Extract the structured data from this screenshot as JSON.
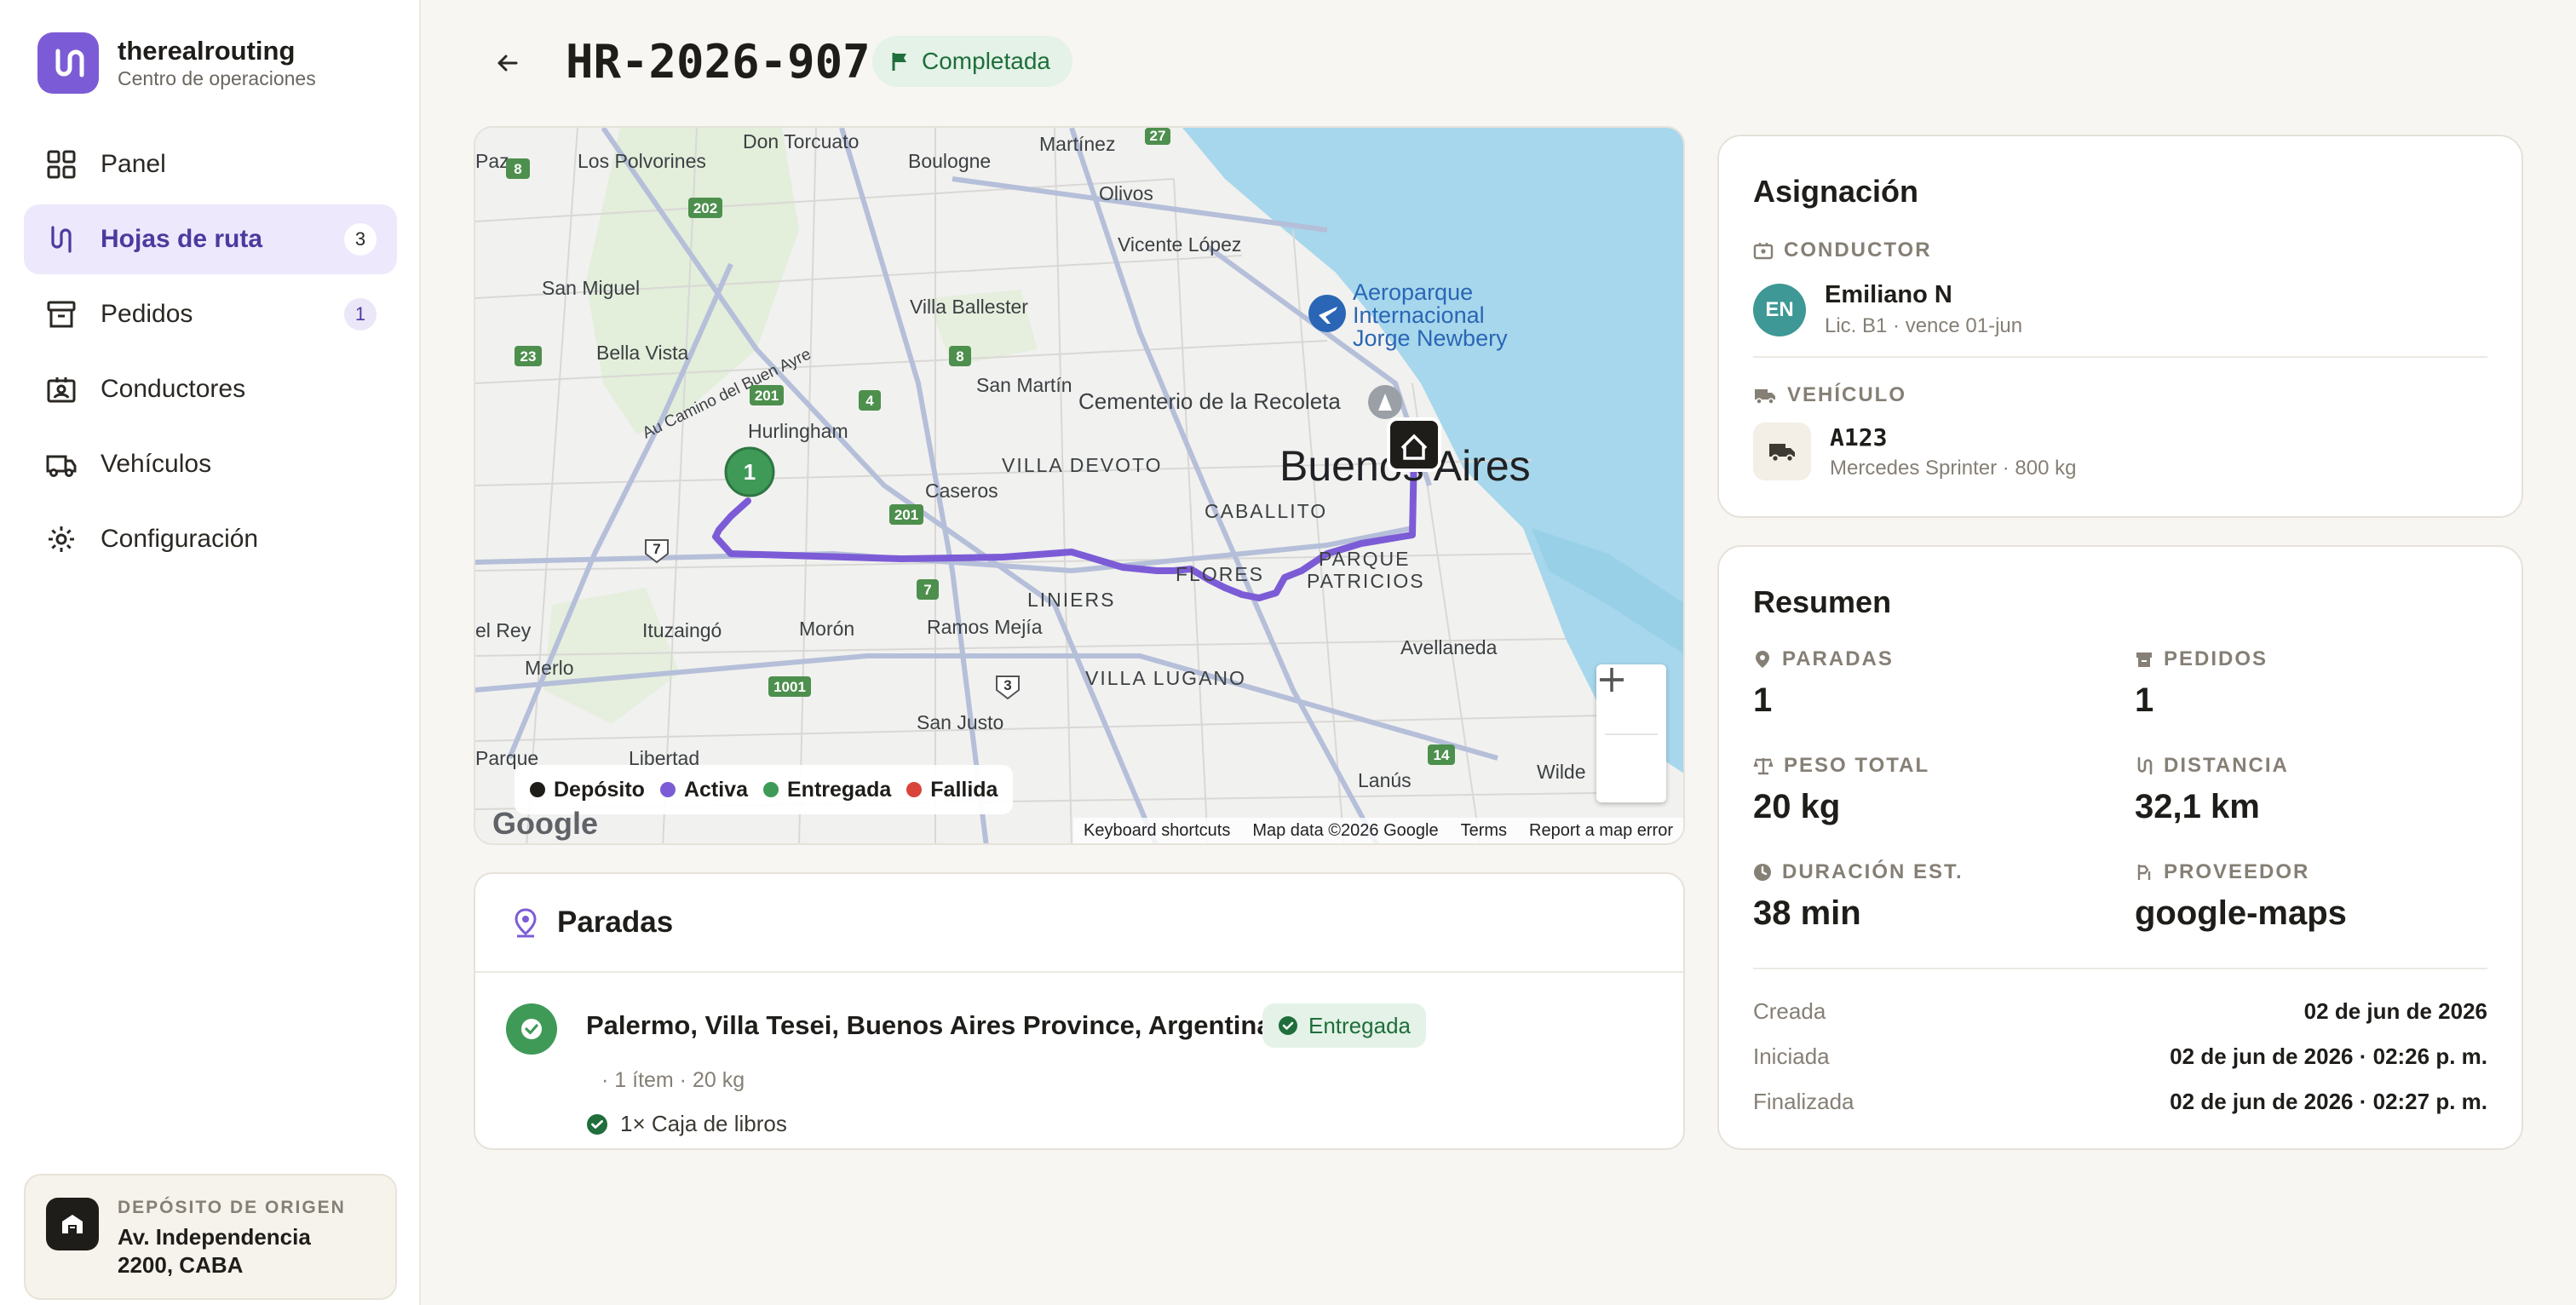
{
  "brand": {
    "name": "therealrouting",
    "subtitle": "Centro de operaciones"
  },
  "nav": [
    {
      "label": "Panel",
      "icon": "grid-icon",
      "badge": ""
    },
    {
      "label": "Hojas de ruta",
      "icon": "route-icon",
      "badge": "3",
      "active": true
    },
    {
      "label": "Pedidos",
      "icon": "archive-icon",
      "badge": "1"
    },
    {
      "label": "Conductores",
      "icon": "id-card-icon",
      "badge": ""
    },
    {
      "label": "Vehículos",
      "icon": "truck-icon",
      "badge": ""
    },
    {
      "label": "Configuración",
      "icon": "gear-icon",
      "badge": ""
    }
  ],
  "depot": {
    "kicker": "DEPÓSITO DE ORIGEN",
    "address_line1": "Av. Independencia",
    "address_line2": "2200, CABA"
  },
  "header": {
    "route_id": "HR-2026-907",
    "status": "Completada"
  },
  "map": {
    "labels": {
      "los_polvorines": "Los Polvorines",
      "don_torcuato": "Don Torcuato",
      "boulogne": "Boulogne",
      "martinez": "Martínez",
      "olivos": "Olivos",
      "vicente_lopez": "Vicente López",
      "paz": "Paz",
      "san_miguel": "San Miguel",
      "villa_ballester": "Villa Ballester",
      "bella_vista": "Bella Vista",
      "san_martin": "San Martín",
      "cementerio": "Cementerio de la Recoleta",
      "hurlingham": "Hurlingham",
      "au_camino": "Au Camino del Buen Ayre",
      "villa_devoto": "VILLA DEVOTO",
      "caseros": "Caseros",
      "buenos_aires": "Buenos Aires",
      "caballito": "CABALLITO",
      "aeroparque": "Aeroparque",
      "internacional": "Internacional",
      "jorge_newbery": "Jorge Newbery",
      "flores": "FLORES",
      "parque": "PARQUE",
      "patricios": "PATRICIOS",
      "liniers": "LINIERS",
      "el_rey": "el Rey",
      "ituzaingo": "Ituzaingó",
      "moron": "Morón",
      "ramos_mejia": "Ramos Mejía",
      "merlo": "Merlo",
      "villa_lugano": "VILLA LUGANO",
      "avellaneda": "Avellaneda",
      "san_justo": "San Justo",
      "parque_w": "Parque",
      "libertad": "Libertad",
      "lanus": "Lanús",
      "wilde": "Wilde"
    },
    "shields": [
      "8",
      "202",
      "27",
      "23",
      "201",
      "4",
      "8",
      "7",
      "201",
      "7",
      "3",
      "1001",
      "14"
    ],
    "stop_marker": "1",
    "legend": [
      {
        "label": "Depósito",
        "color": "#1f1d1a"
      },
      {
        "label": "Activa",
        "color": "#7c5cd6"
      },
      {
        "label": "Entregada",
        "color": "#3f9a58"
      },
      {
        "label": "Fallida",
        "color": "#d9443a"
      }
    ],
    "google": "Google",
    "attribution": {
      "shortcuts": "Keyboard shortcuts",
      "data": "Map data ©2026 Google",
      "terms": "Terms",
      "report": "Report a map error"
    }
  },
  "stops": {
    "title": "Paradas",
    "items": [
      {
        "number": "1",
        "address": "Palermo, Villa Tesei, Buenos Aires Province, Argentina",
        "status": "Entregada",
        "meta": "· 1 ítem · 20 kg",
        "line_item": "1× Caja de libros"
      }
    ]
  },
  "assignment": {
    "title": "Asignación",
    "driver_kicker": "CONDUCTOR",
    "driver_initials": "EN",
    "driver_name": "Emiliano N",
    "driver_sub": "Lic. B1 · vence 01-jun",
    "vehicle_kicker": "VEHÍCULO",
    "vehicle_plate": "A123",
    "vehicle_sub": "Mercedes Sprinter · 800 kg"
  },
  "summary": {
    "title": "Resumen",
    "metrics": [
      {
        "label": "PARADAS",
        "value": "1",
        "icon": "pin-icon"
      },
      {
        "label": "PEDIDOS",
        "value": "1",
        "icon": "archive-icon"
      },
      {
        "label": "PESO TOTAL",
        "value": "20 kg",
        "icon": "scale-icon"
      },
      {
        "label": "DISTANCIA",
        "value": "32,1 km",
        "icon": "route-icon"
      },
      {
        "label": "DURACIÓN EST.",
        "value": "38 min",
        "icon": "clock-icon"
      },
      {
        "label": "PROVEEDOR",
        "value": "google-maps",
        "icon": "provider-icon"
      }
    ],
    "timeline": [
      {
        "label": "Creada",
        "value": "02 de jun de 2026"
      },
      {
        "label": "Iniciada",
        "value": "02 de jun de 2026 · 02:26 p. m."
      },
      {
        "label": "Finalizada",
        "value": "02 de jun de 2026 · 02:27 p. m."
      }
    ]
  }
}
